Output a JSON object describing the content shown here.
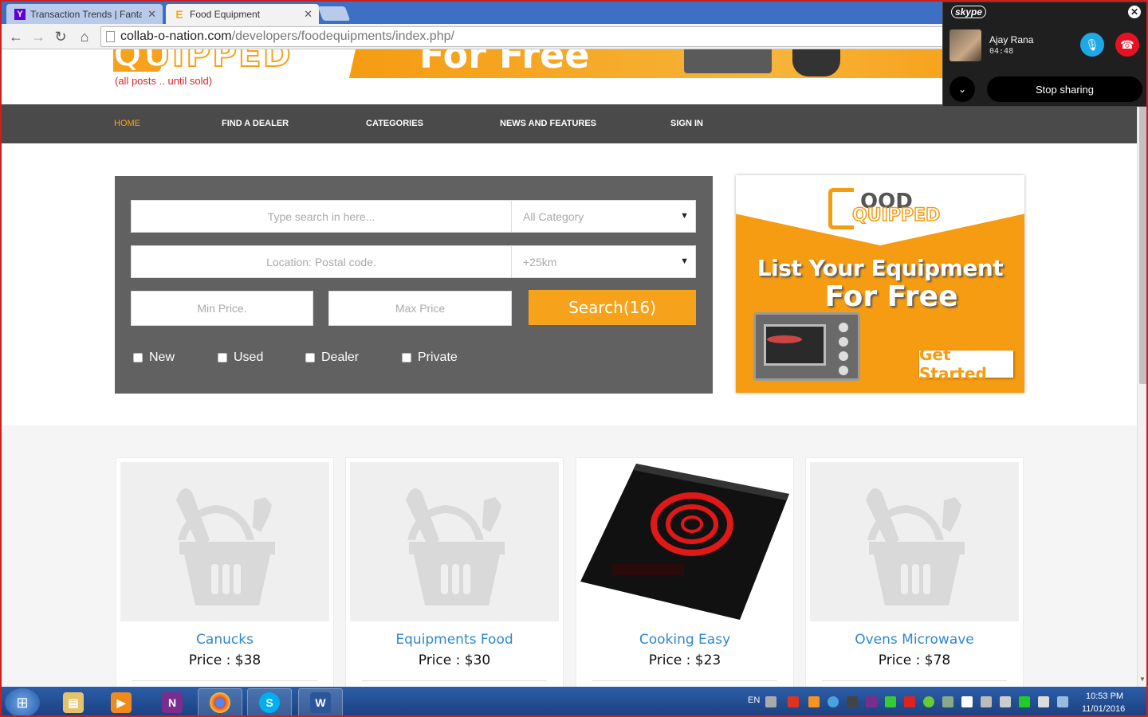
{
  "browser": {
    "tabs": [
      {
        "title": "Transaction Trends | Fanta",
        "favicon": "yahoo-icon",
        "active": false
      },
      {
        "title": "Food Equipment",
        "favicon": "foodequipped-icon",
        "active": true
      }
    ],
    "url_host": "collab-o-nation.com",
    "url_path": "/developers/foodequipments/index.php/"
  },
  "site": {
    "logo_word": "QUIPPED",
    "tagline": "(all posts .. until sold)",
    "top_banner_text": "For Free",
    "nav": [
      "HOME",
      "FIND A DEALER",
      "CATEGORIES",
      "NEWS AND FEATURES",
      "SIGN IN"
    ],
    "accent_color": "#f7a21b"
  },
  "search": {
    "keyword_placeholder": "Type search in here...",
    "category_selected": "All Category",
    "location_placeholder": "Location: Postal code.",
    "radius_selected": "+25km",
    "min_price_placeholder": "Min Price.",
    "max_price_placeholder": "Max Price",
    "button_label": "Search(16)",
    "filters": [
      "New",
      "Used",
      "Dealer",
      "Private"
    ]
  },
  "promo": {
    "logo_ood": "OOD",
    "logo_quipped": "QUIPPED",
    "line1": "List Your Equipment",
    "line2": "For Free",
    "cta": "Get Started"
  },
  "products": [
    {
      "name": "Canucks",
      "price": "Price : $38",
      "image": "basket-placeholder-icon"
    },
    {
      "name": "Equipments Food",
      "price": "Price : $30",
      "image": "basket-placeholder-icon"
    },
    {
      "name": "Cooking Easy",
      "price": "Price : $23",
      "image": "induction-cooktop-photo"
    },
    {
      "name": "Ovens Microwave",
      "price": "Price : $78",
      "image": "basket-placeholder-icon"
    }
  ],
  "skype": {
    "logo": "skype",
    "caller": "Ajay Rana",
    "duration": "04:48",
    "stop_label": "Stop sharing"
  },
  "taskbar": {
    "lang": "EN",
    "time": "10:53 PM",
    "date": "11/01/2016"
  }
}
